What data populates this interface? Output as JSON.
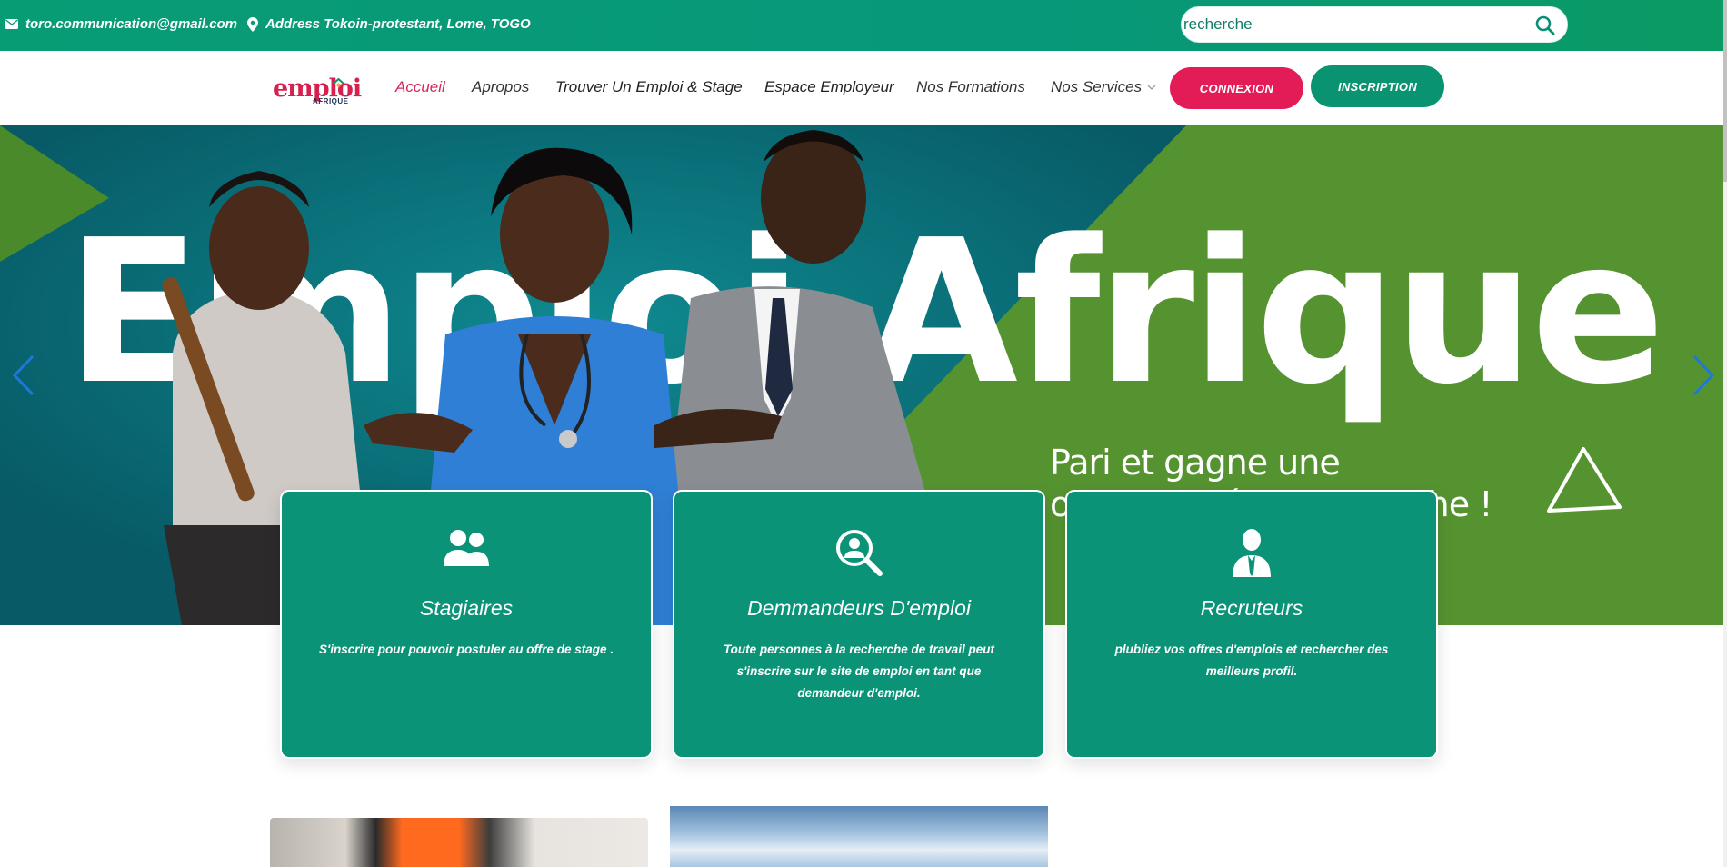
{
  "topbar": {
    "email": "toro.communication@gmail.com",
    "address": "Address Tokoin-protestant, Lome, TOGO",
    "search_placeholder": "recherche"
  },
  "logo": {
    "main": "emploi",
    "sub": "AFRIQUE"
  },
  "nav": {
    "items": [
      {
        "label": "Accueil"
      },
      {
        "label": "Apropos"
      },
      {
        "label": "Trouver Un Emploi & Stage"
      },
      {
        "label": "Espace Employeur"
      },
      {
        "label": "Nos Formations"
      },
      {
        "label": "Nos Services"
      }
    ],
    "connexion": "CONNEXION",
    "inscription": "INSCRIPTION"
  },
  "hero": {
    "title": "Emploi Afrique",
    "tagline": "Pari et gagne une opportunité qui te touche !"
  },
  "cards": [
    {
      "title": "Stagiaires",
      "desc": "S'inscrire pour pouvoir postuler au offre de stage .",
      "icon": "users-icon"
    },
    {
      "title": "Demmandeurs D'emploi",
      "desc": "Toute personnes à la recherche de travail peut s'inscrire sur le site de emploi en tant que demandeur d'emploi.",
      "icon": "search-user-icon"
    },
    {
      "title": "Recruteurs",
      "desc": "plubliez vos offres d'emplois et rechercher des meilleurs profil.",
      "icon": "businessman-icon"
    }
  ],
  "colors": {
    "topbar": "#089c75",
    "accent_red": "#e31c57",
    "accent_green": "#0a9370",
    "hero_green": "#559331",
    "hero_teal": "#0a6e78"
  }
}
